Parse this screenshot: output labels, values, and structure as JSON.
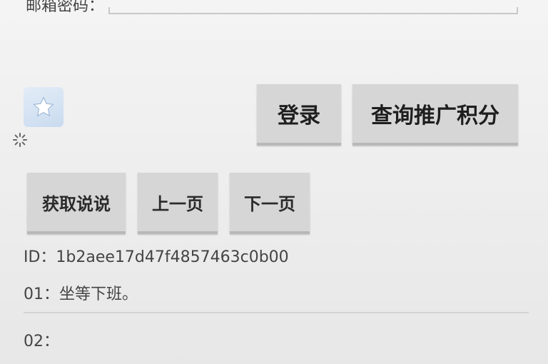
{
  "form": {
    "top_label": "邮箱密码："
  },
  "buttons": {
    "login": "登录",
    "query_points": "查询推广积分",
    "get_posts": "获取说说",
    "prev_page": "上一页",
    "next_page": "下一页"
  },
  "result": {
    "id_line": "ID：1b2aee17d47f4857463c0b00",
    "items": [
      {
        "label": "01：坐等下班。"
      },
      {
        "label": "02："
      }
    ]
  },
  "icons": {
    "star": "star-icon",
    "loading": "loading-spinner-icon"
  },
  "colors": {
    "button_bg": "#d6d6d6",
    "star_tile": "#c9dbef"
  }
}
